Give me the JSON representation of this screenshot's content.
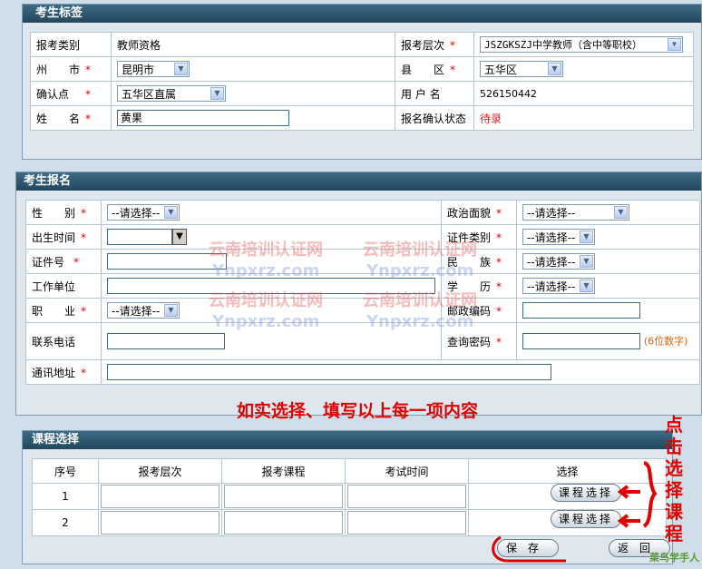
{
  "section1": {
    "title": "考生标签",
    "exam_type_label": "报考类别",
    "exam_type_value": "教师资格",
    "level_label": "报考层次",
    "level_value": "JSZGKSZJ中学教师（含中等职校）",
    "city_label": "州　　市",
    "city_value": "昆明市",
    "county_label": "县　　区",
    "county_value": "五华区",
    "confirm_point_label": "确认点",
    "confirm_point_value": "五华区直属",
    "username_label": "用 户 名",
    "username_value": "526150442",
    "name_label": "姓　　名",
    "name_value": "黄果",
    "status_label": "报名确认状态",
    "status_value": "待录"
  },
  "section2": {
    "title": "考生报名",
    "gender_label": "性　　别",
    "gender_value": "--请选择--",
    "political_label": "政治面貌",
    "political_value": "--请选择--",
    "birth_label": "出生时间",
    "id_type_label": "证件类别",
    "id_type_value": "--请选择--",
    "id_no_label": "证件号",
    "ethnic_label": "民　　族",
    "ethnic_value": "--请选择--",
    "work_label": "工作单位",
    "education_label": "学　　历",
    "education_value": "--请选择--",
    "job_label": "职　　业",
    "job_value": "--请选择--",
    "postcode_label": "邮政编码",
    "phone_label": "联系电话",
    "query_pwd_label": "查询密码",
    "query_pwd_hint": "(6位数字)",
    "address_label": "通讯地址"
  },
  "annotation_fill": "如实选择、填写以上每一项内容",
  "annotation_click": "点击选择课程",
  "watermark": {
    "cn": "云南培训认证网",
    "en": "Ynpxrz.com"
  },
  "section3": {
    "title": "课程选择",
    "headers": [
      "序号",
      "报考层次",
      "报考课程",
      "考试时间",
      "选择"
    ],
    "rows": [
      {
        "no": "1",
        "button": "课程选择"
      },
      {
        "no": "2",
        "button": "课程选择"
      }
    ],
    "save_button": "保存",
    "back_button": "返回"
  },
  "corner_logo": "菜鸟学手人",
  "colors": {
    "header": "#2f5a74",
    "required": "#e00000",
    "annotation": "#e00000",
    "page_bg": "#cfdee8"
  }
}
